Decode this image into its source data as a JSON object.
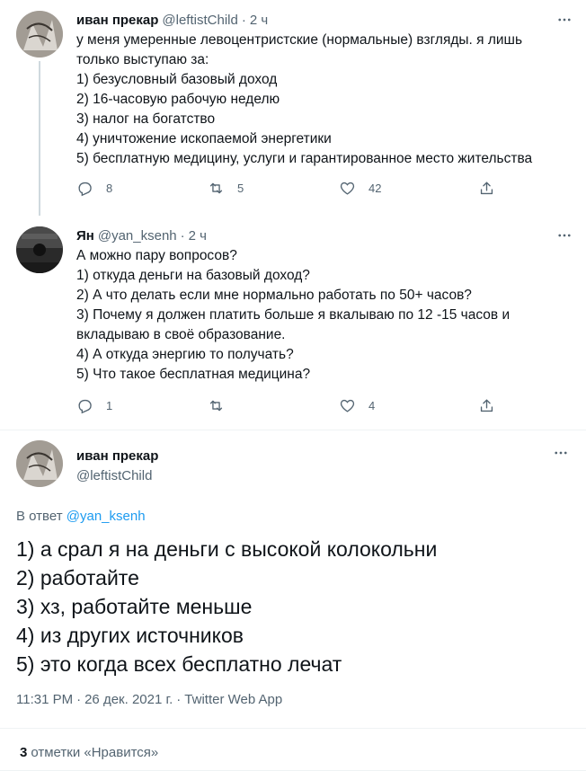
{
  "tweets": [
    {
      "name": "иван прекар",
      "handle": "@leftistChild",
      "dot": "·",
      "time": "2 ч",
      "icons": {
        "avatar": "avatar-image",
        "more": "more-dots-icon"
      },
      "lines": [
        "у меня умеренные левоцентристские (нормальные) взгляды. я лишь",
        "только выступаю за:",
        "1) безусловный базовый доход",
        "2) 16-часовую рабочую неделю",
        "3) налог на богатство",
        "4) уничтожение ископаемой энергетики",
        "5) бесплатную медицину, услуги и гарантированное место жительства"
      ],
      "replies": "8",
      "retweets": "5",
      "likes": "42"
    },
    {
      "name": "Ян",
      "handle": "@yan_ksenh",
      "dot": "·",
      "time": "2 ч",
      "icons": {
        "avatar": "avatar-image",
        "more": "more-dots-icon"
      },
      "lines": [
        "А можно пару вопросов?",
        "1) откуда деньги на базовый доход?",
        "2) А что делать если мне нормально работать по 50+ часов?",
        "3) Почему я должен платить больше я вкалываю по 12 -15 часов и",
        "вкладываю в своё образование.",
        "4) А откуда энергию то получать?",
        "5) Что такое бесплатная медицина?"
      ],
      "replies": "1",
      "retweets": "",
      "likes": "4"
    }
  ],
  "main": {
    "name": "иван прекар",
    "handle": "@leftistChild",
    "reply_prefix": "В ответ",
    "reply_handle": "@yan_ksenh",
    "lines": [
      "1) а срал я на деньги с высокой колокольни",
      "2) работайте",
      "3) хз, работайте меньше",
      "4) из других источников",
      "5) это когда всех бесплатно лечат"
    ],
    "time": "11:31 PM",
    "dot": "·",
    "date": "26 дек. 2021 г.",
    "dot2": "·",
    "source": "Twitter Web App",
    "like_count": "3",
    "like_label": "отметки «Нравится»"
  },
  "colors": {
    "text": "#0f1419",
    "secondary": "#536471",
    "link": "#1d9bf0",
    "divider": "#eff3f4"
  }
}
